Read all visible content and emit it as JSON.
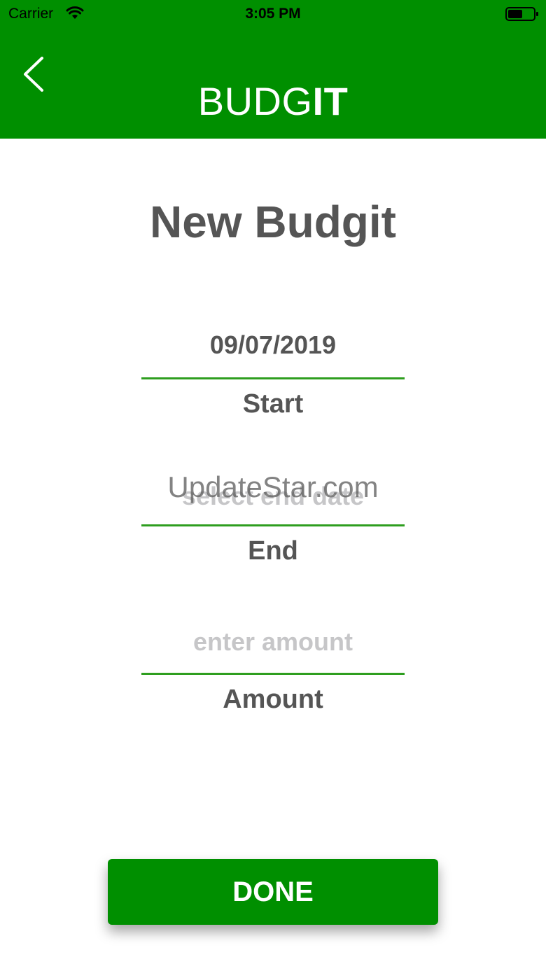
{
  "status_bar": {
    "carrier": "Carrier",
    "time": "3:05 PM"
  },
  "nav": {
    "brand_light": "BUDG",
    "brand_bold": "IT",
    "back_icon": "chevron-left-icon"
  },
  "page": {
    "title": "New Budgit"
  },
  "fields": {
    "start": {
      "value": "09/07/2019",
      "label": "Start"
    },
    "end": {
      "placeholder": "select end date",
      "label": "End"
    },
    "amount": {
      "placeholder": "enter amount",
      "label": "Amount"
    }
  },
  "watermark": "UpdateStar.com",
  "actions": {
    "done_label": "DONE"
  },
  "colors": {
    "primary_green": "#008f00",
    "underline_green": "#2e9e1f",
    "text_gray": "#555555",
    "placeholder_gray": "#c6c6c8"
  }
}
